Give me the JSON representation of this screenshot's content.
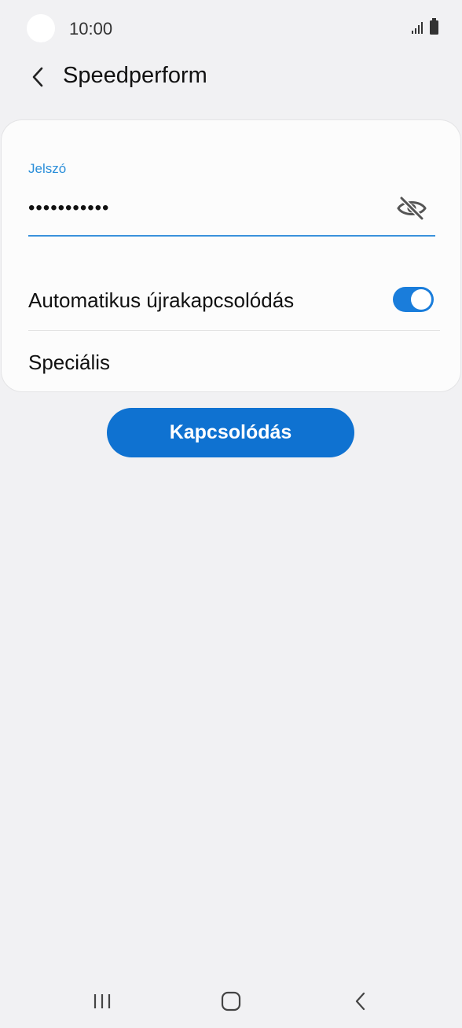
{
  "status_bar": {
    "time": "10:00",
    "icons": [
      "signal-icon",
      "battery-icon"
    ]
  },
  "header": {
    "back_icon": "chevron-left-icon",
    "title": "Speedperform"
  },
  "form": {
    "password_label": "Jelszó",
    "password_value": "•••••••••••",
    "visibility_icon": "eye-off-icon",
    "auto_reconnect_label": "Automatikus újrakapcsolódás",
    "auto_reconnect_enabled": true,
    "advanced_label": "Speciális"
  },
  "actions": {
    "connect_label": "Kapcsolódás"
  },
  "navigation": {
    "buttons": [
      "recent-apps-icon",
      "home-icon",
      "back-icon"
    ]
  },
  "colors": {
    "accent": "#0f72d1",
    "label_blue": "#2a8ed9",
    "background": "#f1f1f3"
  }
}
